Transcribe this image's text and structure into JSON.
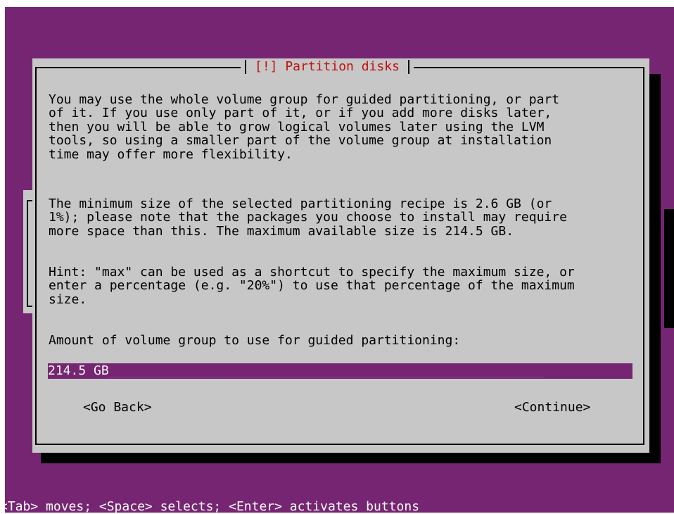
{
  "dialog": {
    "title": "[!] Partition disks",
    "paragraph1": "You may use the whole volume group for guided partitioning, or part\nof it. If you use only part of it, or if you add more disks later,\nthen you will be able to grow logical volumes later using the LVM\ntools, so using a smaller part of the volume group at installation\ntime may offer more flexibility.",
    "paragraph2": "The minimum size of the selected partitioning recipe is 2.6 GB (or\n1%); please note that the packages you choose to install may require\nmore space than this. The maximum available size is 214.5 GB.",
    "paragraph3": "Hint: \"max\" can be used as a shortcut to specify the maximum size, or\nenter a percentage (e.g. \"20%\") to use that percentage of the maximum\nsize.",
    "prompt": "Amount of volume group to use for guided partitioning:",
    "input_value": "214.5 GB",
    "input_fill": "_________________________________________________________",
    "go_back_label": "<Go Back>",
    "continue_label": "<Continue>"
  },
  "status_bar": {
    "text": "<Tab> moves; <Space> selects; <Enter> activates buttons"
  },
  "colors": {
    "background": "#762572",
    "dialog": "#c7c7c7",
    "title": "#c10f0f",
    "input_bg": "#762572",
    "input_text": "#ffffff"
  }
}
